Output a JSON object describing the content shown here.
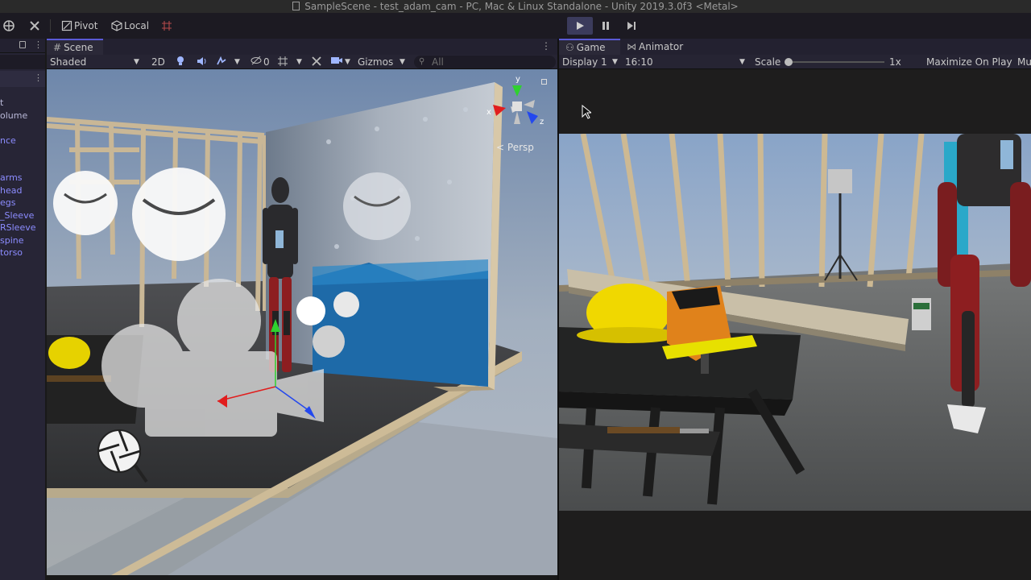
{
  "window": {
    "title": "SampleScene - test_adam_cam - PC, Mac & Linux Standalone - Unity 2019.3.0f3 <Metal>"
  },
  "toolbar": {
    "pivot_label": "Pivot",
    "local_label": "Local"
  },
  "hierarchy": {
    "items": [
      "t",
      "olume",
      "",
      "nce",
      "",
      "",
      "arms",
      "head",
      "egs",
      "_Sleeve",
      "RSleeve",
      "spine",
      "torso"
    ]
  },
  "scene": {
    "tab_label": "Scene",
    "shading_mode": "Shaded",
    "mode_2d": "2D",
    "layers_count": "0",
    "gizmos_label": "Gizmos",
    "search_placeholder": "All",
    "projection_label": "Persp",
    "axis_x": "x",
    "axis_y": "y",
    "axis_z": "z"
  },
  "game": {
    "tab_label": "Game",
    "animator_tab_label": "Animator",
    "display": "Display 1",
    "aspect": "16:10",
    "scale_label": "Scale",
    "scale_value": "1x",
    "maximize_label": "Maximize On Play",
    "mute_label": "Mu",
    "scale_fraction": 0
  },
  "colors": {
    "accent": "#5a5ad6",
    "axis_x": "#e11d1d",
    "axis_y": "#2fd12f",
    "axis_z": "#2348ee"
  }
}
